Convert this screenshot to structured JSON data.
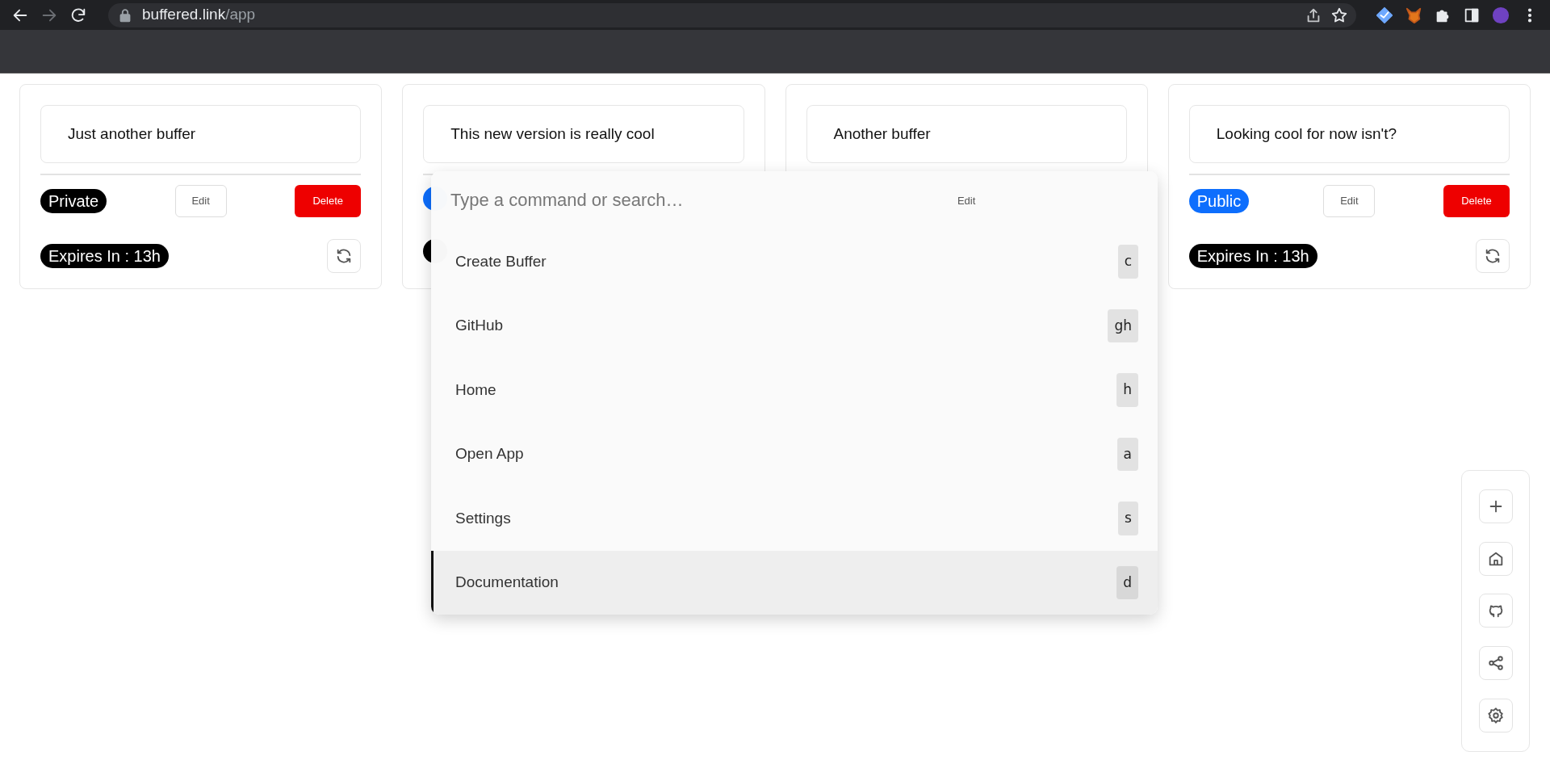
{
  "browser": {
    "url_host": "buffered.link",
    "url_path": "/app",
    "forward_disabled": true
  },
  "cards": [
    {
      "text": "Just another buffer",
      "covered": false,
      "badge": {
        "kind": "private",
        "label": "Private"
      },
      "edit": "Edit",
      "delete": "Delete",
      "expires": "Expires In : 13h"
    },
    {
      "text": "This new version is really cool",
      "covered": true,
      "badge": {
        "kind": "public"
      },
      "expiry_badge": true
    },
    {
      "text": "Another buffer",
      "covered": true,
      "edit": "Edit"
    },
    {
      "text": "Looking cool for now isn't?",
      "covered": false,
      "badge": {
        "kind": "public",
        "label": "Public"
      },
      "edit": "Edit",
      "delete": "Delete",
      "expires": "Expires In : 13h"
    }
  ],
  "command_palette": {
    "placeholder": "Type a command or search…",
    "items": [
      {
        "label": "Create Buffer",
        "shortcut": "c",
        "selected": false
      },
      {
        "label": "GitHub",
        "shortcut": "gh",
        "selected": false
      },
      {
        "label": "Home",
        "shortcut": "h",
        "selected": false
      },
      {
        "label": "Open App",
        "shortcut": "a",
        "selected": false
      },
      {
        "label": "Settings",
        "shortcut": "s",
        "selected": false
      },
      {
        "label": "Documentation",
        "shortcut": "d",
        "selected": true
      }
    ]
  },
  "sidebar": [
    {
      "kind": "plus"
    },
    {
      "kind": "home"
    },
    {
      "kind": "github"
    },
    {
      "kind": "share"
    },
    {
      "kind": "settings"
    }
  ]
}
